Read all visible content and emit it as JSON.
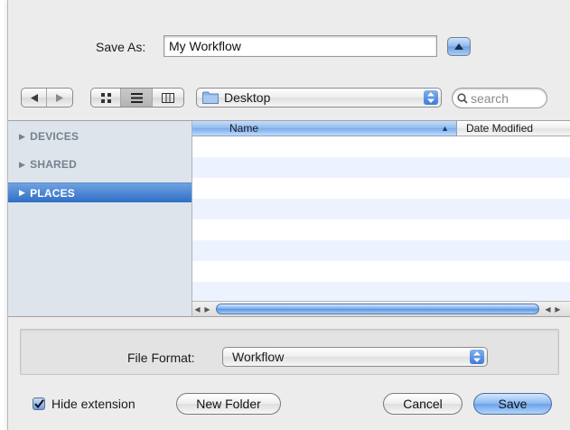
{
  "save_as": {
    "label": "Save As:",
    "value": "My Workflow",
    "expand_icon": "triangle-up-icon"
  },
  "toolbar": {
    "nav": [
      {
        "icon": "back-arrow-icon"
      },
      {
        "icon": "forward-arrow-icon"
      }
    ],
    "views": [
      {
        "icon": "icon-view-icon"
      },
      {
        "icon": "list-view-icon",
        "selected": true
      },
      {
        "icon": "column-view-icon"
      }
    ],
    "location": "Desktop",
    "search_placeholder": "search"
  },
  "sidebar": {
    "items": [
      {
        "label": "DEVICES",
        "selected": false
      },
      {
        "label": "SHARED",
        "selected": false
      },
      {
        "label": "PLACES",
        "selected": true
      }
    ]
  },
  "file_list": {
    "columns": [
      "Name",
      "Date Modified"
    ],
    "sort_column": "Name",
    "rows": []
  },
  "file_format": {
    "label": "File Format:",
    "value": "Workflow"
  },
  "footer": {
    "hide_extension_label": "Hide extension",
    "hide_extension_checked": true,
    "new_folder_label": "New Folder",
    "cancel_label": "Cancel",
    "save_label": "Save"
  },
  "colors": {
    "accent": "#3f7bd8",
    "sidebar_bg": "#dde4ec",
    "selected_row": "#2f6fc7",
    "stripe": "#edf3fe"
  }
}
